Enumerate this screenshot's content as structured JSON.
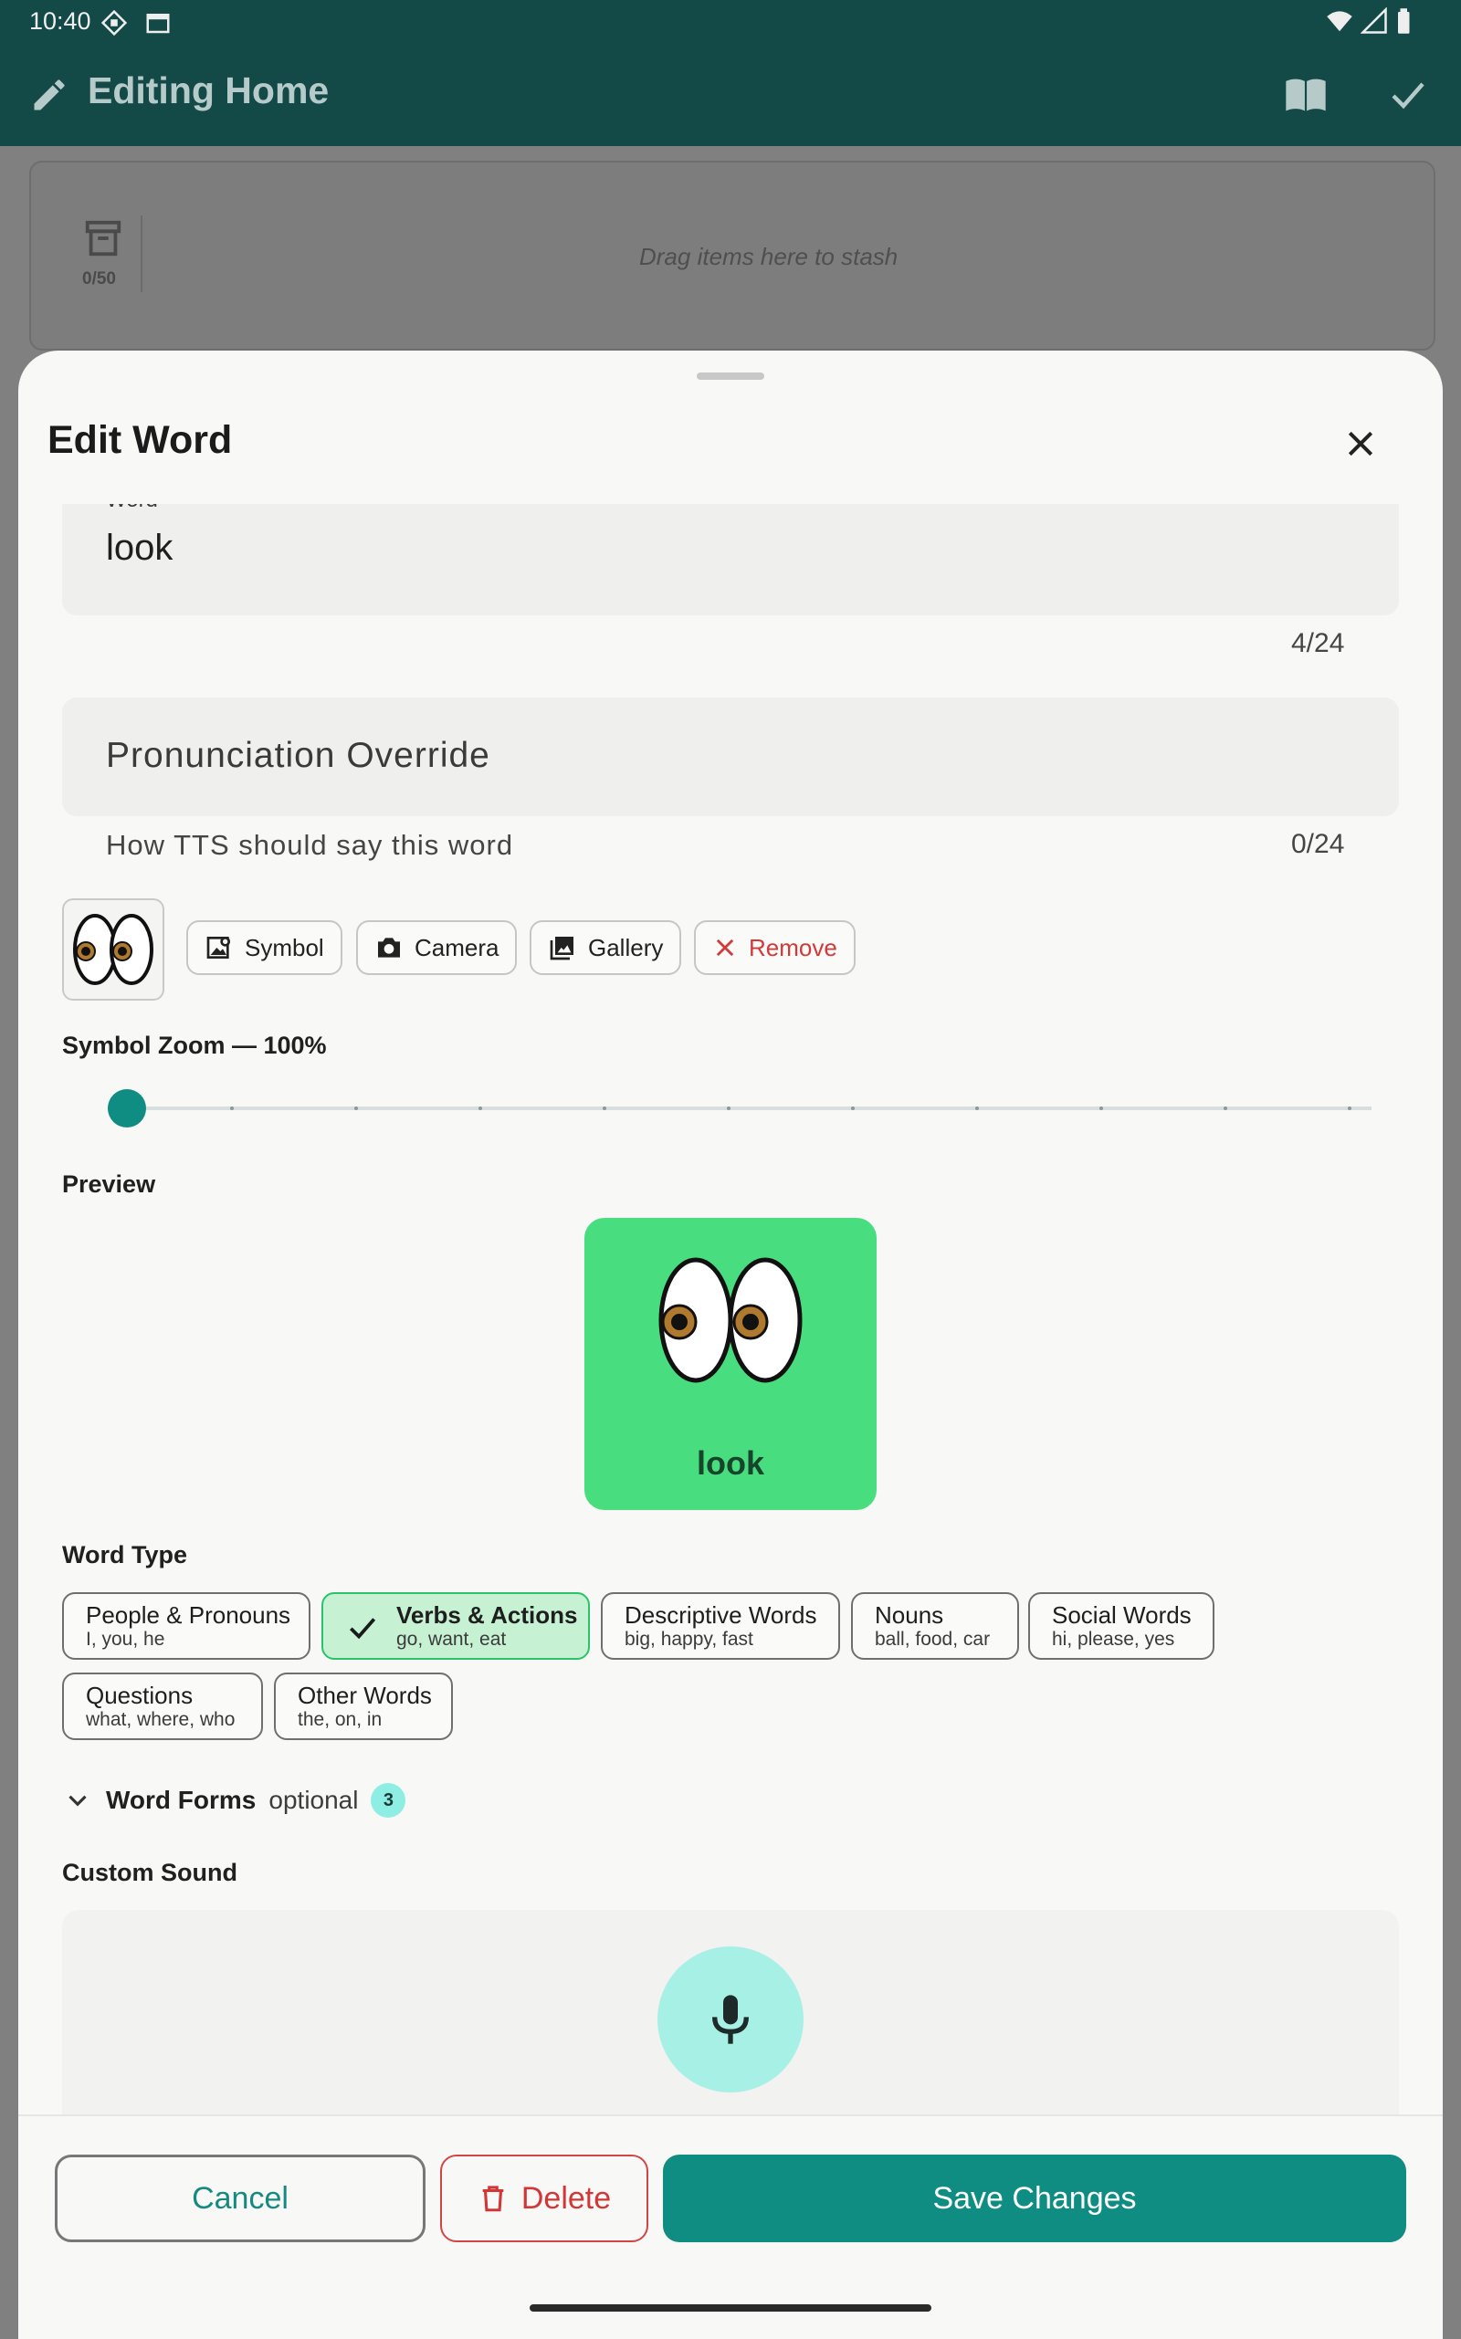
{
  "status_bar": {
    "time": "10:40"
  },
  "app_bar": {
    "title": "Editing Home"
  },
  "stash": {
    "count": "0/50",
    "hint": "Drag items here to stash"
  },
  "sheet": {
    "title": "Edit Word",
    "word_field": {
      "label": "Word",
      "value": "look",
      "counter": "4/24"
    },
    "pronunciation_field": {
      "placeholder": "Pronunciation Override",
      "helper": "How TTS should say this word",
      "counter": "0/24"
    },
    "image_buttons": {
      "symbol": "Symbol",
      "camera": "Camera",
      "gallery": "Gallery",
      "remove": "Remove"
    },
    "zoom": {
      "label": "Symbol Zoom — 100%",
      "value": 1.0
    },
    "preview": {
      "label": "Preview",
      "word": "look",
      "card_color": "#48de80"
    },
    "word_type": {
      "label": "Word Type",
      "chips": [
        {
          "title": "People & Pronouns",
          "sub": "I, you, he",
          "selected": false
        },
        {
          "title": "Verbs & Actions",
          "sub": "go, want, eat",
          "selected": true
        },
        {
          "title": "Descriptive Words",
          "sub": "big, happy, fast",
          "selected": false
        },
        {
          "title": "Nouns",
          "sub": "ball, food, car",
          "selected": false
        },
        {
          "title": "Social Words",
          "sub": "hi, please, yes",
          "selected": false
        },
        {
          "title": "Questions",
          "sub": "what, where, who",
          "selected": false
        },
        {
          "title": "Other Words",
          "sub": "the, on, in",
          "selected": false
        }
      ]
    },
    "word_forms": {
      "label": "Word Forms",
      "optional": "optional",
      "count": "3"
    },
    "custom_sound": {
      "label": "Custom Sound"
    }
  },
  "footer": {
    "cancel": "Cancel",
    "delete": "Delete",
    "save": "Save Changes"
  },
  "colors": {
    "accent": "#0f8d82",
    "danger": "#d23636",
    "appbar": "#134a47"
  }
}
